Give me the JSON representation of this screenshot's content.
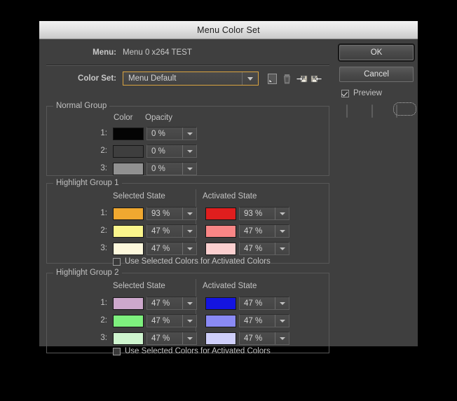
{
  "window": {
    "title": "Menu Color Set"
  },
  "header": {
    "menu_label": "Menu:",
    "menu_value": "Menu 0 x264 TEST",
    "colorset_label": "Color Set:",
    "colorset_value": "Menu Default",
    "icons": [
      {
        "name": "new-color-set-icon",
        "title": "New Color Set"
      },
      {
        "name": "delete-color-set-icon",
        "title": "Delete Color Set"
      },
      {
        "name": "import-color-set-icon",
        "title": "Import Color Set"
      },
      {
        "name": "export-color-set-icon",
        "title": "Export Color Set"
      }
    ]
  },
  "normal_group": {
    "title": "Normal Group",
    "col_color": "Color",
    "col_opacity": "Opacity",
    "rows": [
      {
        "label": "1:",
        "color": "#040404",
        "opacity": "0 %"
      },
      {
        "label": "2:",
        "color": "#3e3e3e",
        "opacity": "0 %"
      },
      {
        "label": "3:",
        "color": "#919191",
        "opacity": "0 %"
      }
    ]
  },
  "highlight_group_1": {
    "title": "Highlight Group 1",
    "col_selected": "Selected State",
    "col_activated": "Activated State",
    "rows": [
      {
        "label": "1:",
        "selected_color": "#f0a830",
        "selected_opacity": "93 %",
        "activated_color": "#e01e1e",
        "activated_opacity": "93 %"
      },
      {
        "label": "2:",
        "selected_color": "#faf58c",
        "selected_opacity": "47 %",
        "activated_color": "#f98686",
        "activated_opacity": "47 %"
      },
      {
        "label": "3:",
        "selected_color": "#fdf8dc",
        "selected_opacity": "47 %",
        "activated_color": "#fbcfcf",
        "activated_opacity": "47 %"
      }
    ],
    "checkbox_label": "Use Selected Colors for Activated Colors",
    "checkbox_checked": false
  },
  "highlight_group_2": {
    "title": "Highlight Group 2",
    "col_selected": "Selected State",
    "col_activated": "Activated State",
    "rows": [
      {
        "label": "1:",
        "selected_color": "#cda8cc",
        "selected_opacity": "47 %",
        "activated_color": "#1414e0",
        "activated_opacity": "47 %"
      },
      {
        "label": "2:",
        "selected_color": "#7ef07e",
        "selected_opacity": "47 %",
        "activated_color": "#8a8af5",
        "activated_opacity": "47 %"
      },
      {
        "label": "3:",
        "selected_color": "#cff5cf",
        "selected_opacity": "47 %",
        "activated_color": "#cfcffa",
        "activated_opacity": "47 %"
      }
    ],
    "checkbox_label": "Use Selected Colors for Activated Colors",
    "checkbox_checked": false
  },
  "actions": {
    "ok_label": "OK",
    "cancel_label": "Cancel",
    "preview_label": "Preview",
    "preview_checked": true,
    "button_shapes": [
      {
        "name": "button-shape-rounded",
        "selected": false
      },
      {
        "name": "button-shape-pill",
        "selected": false
      },
      {
        "name": "button-shape-pill-selected",
        "selected": true
      }
    ]
  },
  "colors": {
    "dialog_bg": "#3f3f3f",
    "titlebar_from": "#f2f2f2",
    "titlebar_to": "#c9c9c9",
    "focus_ring": "#d9a441",
    "text": "#c3c3c3"
  }
}
